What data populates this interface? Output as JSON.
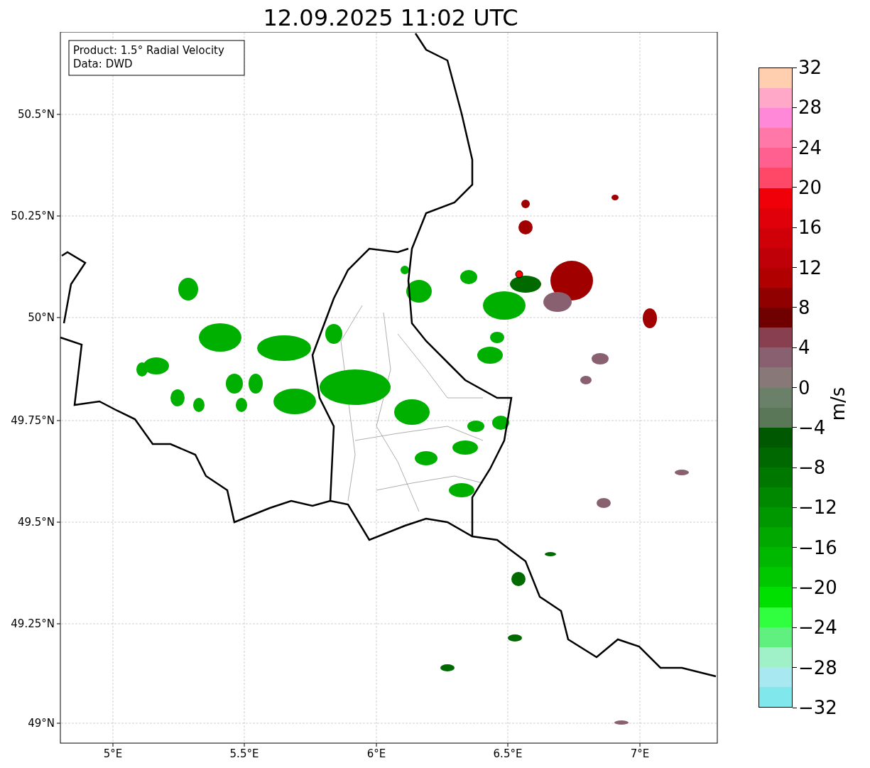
{
  "title": "12.09.2025 11:02 UTC",
  "legend": [
    "Product: 1.5° Radial Velocity",
    "Data: DWD"
  ],
  "map": {
    "yticks": [
      "50.5°N",
      "50.25°N",
      "50°N",
      "49.75°N",
      "49.5°N",
      "49.25°N",
      "49°N"
    ],
    "xticks": [
      "5°E",
      "5.5°E",
      "6°E",
      "6.5°E",
      "7°E"
    ]
  },
  "colorbar": {
    "label": "m/s",
    "ticks": [
      "32",
      "28",
      "24",
      "20",
      "16",
      "12",
      "8",
      "4",
      "0",
      "−4",
      "−8",
      "−12",
      "−16",
      "−20",
      "−24",
      "−28",
      "−32"
    ],
    "bands": [
      {
        "color": "#ffcfb0"
      },
      {
        "color": "#ffa8c8"
      },
      {
        "color": "#ff88d8"
      },
      {
        "color": "#ff78a8"
      },
      {
        "color": "#ff6090"
      },
      {
        "color": "#ff4868"
      },
      {
        "color": "#f00008"
      },
      {
        "color": "#e0000a"
      },
      {
        "color": "#d00008"
      },
      {
        "color": "#c00008"
      },
      {
        "color": "#b00000"
      },
      {
        "color": "#900000"
      },
      {
        "color": "#700000"
      },
      {
        "color": "#884050"
      },
      {
        "color": "#886070"
      },
      {
        "color": "#887878"
      },
      {
        "color": "#6a8068"
      },
      {
        "color": "#5a7858"
      },
      {
        "color": "#005800"
      },
      {
        "color": "#006800"
      },
      {
        "color": "#007800"
      },
      {
        "color": "#008800"
      },
      {
        "color": "#009800"
      },
      {
        "color": "#00a800"
      },
      {
        "color": "#00b800"
      },
      {
        "color": "#00c800"
      },
      {
        "color": "#00e000"
      },
      {
        "color": "#30ff40"
      },
      {
        "color": "#60f080"
      },
      {
        "color": "#a0f0c8"
      },
      {
        "color": "#a8e8f0"
      },
      {
        "color": "#80e8ec"
      }
    ]
  }
}
